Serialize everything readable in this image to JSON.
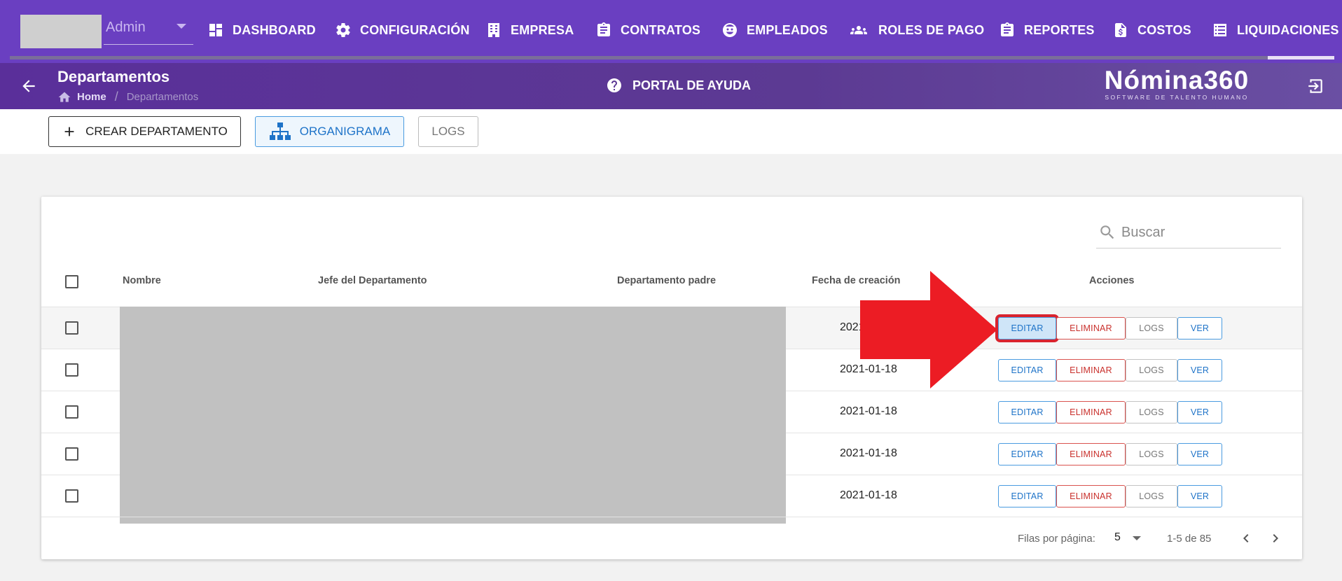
{
  "topnav": {
    "user": "Admin",
    "items": [
      {
        "label": "DASHBOARD",
        "icon": "dashboard-icon"
      },
      {
        "label": "CONFIGURACIÓN",
        "icon": "gear-icon"
      },
      {
        "label": "EMPRESA",
        "icon": "building-icon"
      },
      {
        "label": "CONTRATOS",
        "icon": "clipboard-icon"
      },
      {
        "label": "EMPLEADOS",
        "icon": "face-icon"
      },
      {
        "label": "ROLES DE PAGO",
        "icon": "group-icon"
      },
      {
        "label": "REPORTES",
        "icon": "clipboard-icon"
      },
      {
        "label": "COSTOS",
        "icon": "dollar-file-icon"
      },
      {
        "label": "LIQUIDACIONES",
        "icon": "list-icon"
      }
    ]
  },
  "header": {
    "title": "Departamentos",
    "breadcrumb": {
      "home": "Home",
      "separator": "/",
      "current": "Departamentos"
    },
    "help": "PORTAL DE AYUDA",
    "brand": {
      "name": "Nómina360",
      "tagline": "SOFTWARE DE TALENTO HUMANO"
    }
  },
  "toolbar": {
    "create": "CREAR DEPARTAMENTO",
    "org": "ORGANIGRAMA",
    "logs": "LOGS"
  },
  "search": {
    "placeholder": "Buscar"
  },
  "table": {
    "columns": [
      "Nombre",
      "Jefe del Departamento",
      "Departamento padre",
      "Fecha de creación",
      "Acciones"
    ],
    "rows": [
      {
        "date": "2021"
      },
      {
        "date": "2021-01-18"
      },
      {
        "date": "2021-01-18"
      },
      {
        "date": "2021-01-18"
      },
      {
        "date": "2021-01-18"
      }
    ],
    "actions": {
      "edit": "EDITAR",
      "delete": "ELIMINAR",
      "logs": "LOGS",
      "view": "VER"
    }
  },
  "pagination": {
    "rows_per_page_label": "Filas por página:",
    "rows_per_page": "5",
    "range": "1-5 de 85"
  },
  "colors": {
    "nav_bg": "#6a3fc1",
    "header_bg": "#5a2f9a",
    "accent_blue": "#1e73c8",
    "danger": "#c9302c",
    "annotation_red": "#ec1c24"
  }
}
